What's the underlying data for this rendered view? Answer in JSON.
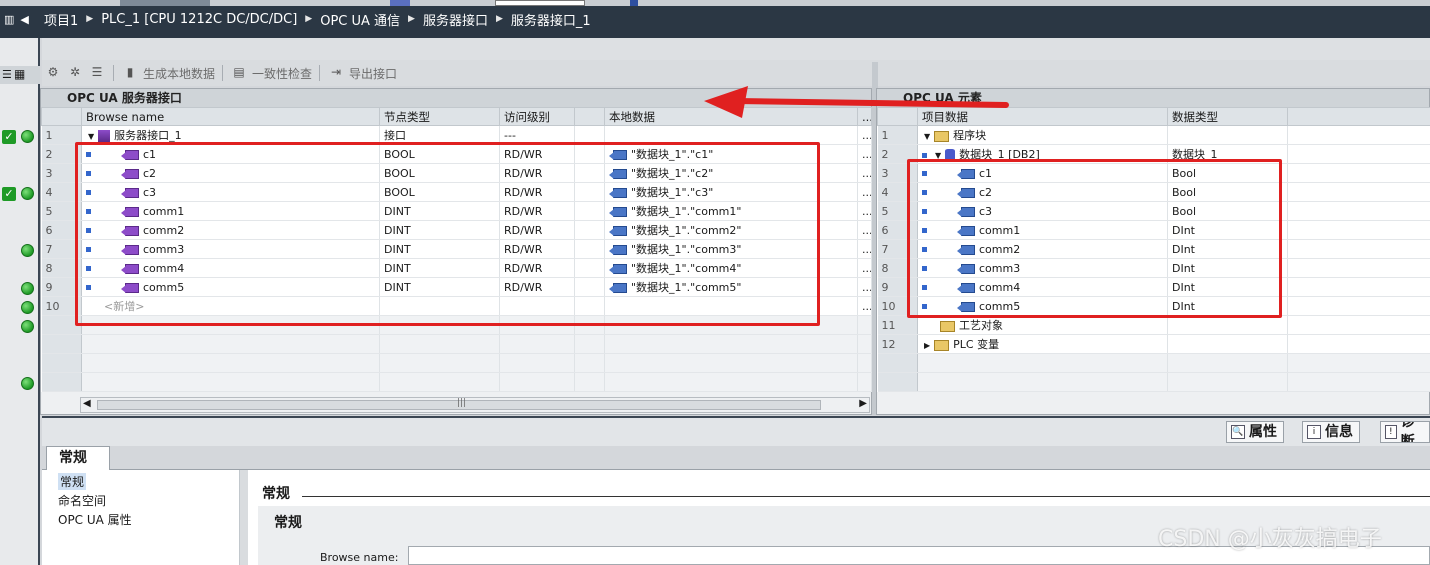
{
  "breadcrumb": [
    "项目1",
    "PLC_1 [CPU 1212C DC/DC/DC]",
    "OPC UA 通信",
    "服务器接口",
    "服务器接口_1"
  ],
  "toolbar": {
    "generate_label": "生成本地数据",
    "consistency_label": "一致性检查",
    "export_label": "导出接口"
  },
  "left_pane": {
    "title": "OPC UA 服务器接口",
    "columns": [
      "Browse name",
      "节点类型",
      "访问级别",
      "本地数据",
      "..."
    ],
    "rows": [
      {
        "num": "1",
        "name": "服务器接口_1",
        "type": "接口",
        "access": "---",
        "local": ""
      },
      {
        "num": "2",
        "name": "c1",
        "type": "BOOL",
        "access": "RD/WR",
        "local": "\"数据块_1\".\"c1\""
      },
      {
        "num": "3",
        "name": "c2",
        "type": "BOOL",
        "access": "RD/WR",
        "local": "\"数据块_1\".\"c2\""
      },
      {
        "num": "4",
        "name": "c3",
        "type": "BOOL",
        "access": "RD/WR",
        "local": "\"数据块_1\".\"c3\""
      },
      {
        "num": "5",
        "name": "comm1",
        "type": "DINT",
        "access": "RD/WR",
        "local": "\"数据块_1\".\"comm1\""
      },
      {
        "num": "6",
        "name": "comm2",
        "type": "DINT",
        "access": "RD/WR",
        "local": "\"数据块_1\".\"comm2\""
      },
      {
        "num": "7",
        "name": "comm3",
        "type": "DINT",
        "access": "RD/WR",
        "local": "\"数据块_1\".\"comm3\""
      },
      {
        "num": "8",
        "name": "comm4",
        "type": "DINT",
        "access": "RD/WR",
        "local": "\"数据块_1\".\"comm4\""
      },
      {
        "num": "9",
        "name": "comm5",
        "type": "DINT",
        "access": "RD/WR",
        "local": "\"数据块_1\".\"comm5\""
      },
      {
        "num": "10",
        "name": "<新增>",
        "type": "",
        "access": "",
        "local": ""
      }
    ],
    "empty_rows": 4
  },
  "right_pane": {
    "title": "OPC UA 元素",
    "columns": [
      "项目数据",
      "数据类型"
    ],
    "rows": [
      {
        "num": "1",
        "name": "程序块",
        "type": ""
      },
      {
        "num": "2",
        "name": "数据块_1 [DB2]",
        "type": "数据块_1"
      },
      {
        "num": "3",
        "name": "c1",
        "type": "Bool"
      },
      {
        "num": "4",
        "name": "c2",
        "type": "Bool"
      },
      {
        "num": "5",
        "name": "c3",
        "type": "Bool"
      },
      {
        "num": "6",
        "name": "comm1",
        "type": "DInt"
      },
      {
        "num": "7",
        "name": "comm2",
        "type": "DInt"
      },
      {
        "num": "8",
        "name": "comm3",
        "type": "DInt"
      },
      {
        "num": "9",
        "name": "comm4",
        "type": "DInt"
      },
      {
        "num": "10",
        "name": "comm5",
        "type": "DInt"
      },
      {
        "num": "11",
        "name": "工艺对象",
        "type": ""
      },
      {
        "num": "12",
        "name": "PLC 变量",
        "type": ""
      }
    ],
    "empty_rows": 2
  },
  "inspector_tabs": [
    "属性",
    "信息",
    "诊断"
  ],
  "properties": {
    "tab": "常规",
    "nav": [
      "常规",
      "命名空间",
      "OPC UA 属性"
    ],
    "section_title": "常规",
    "sub_title": "常规",
    "browse_name_label": "Browse name:"
  },
  "watermark": "CSDN @小灰灰搞电子",
  "colors": {
    "annotation_red": "#e02020",
    "status_green": "#1e9a26",
    "title_bar": "#2b3744"
  }
}
